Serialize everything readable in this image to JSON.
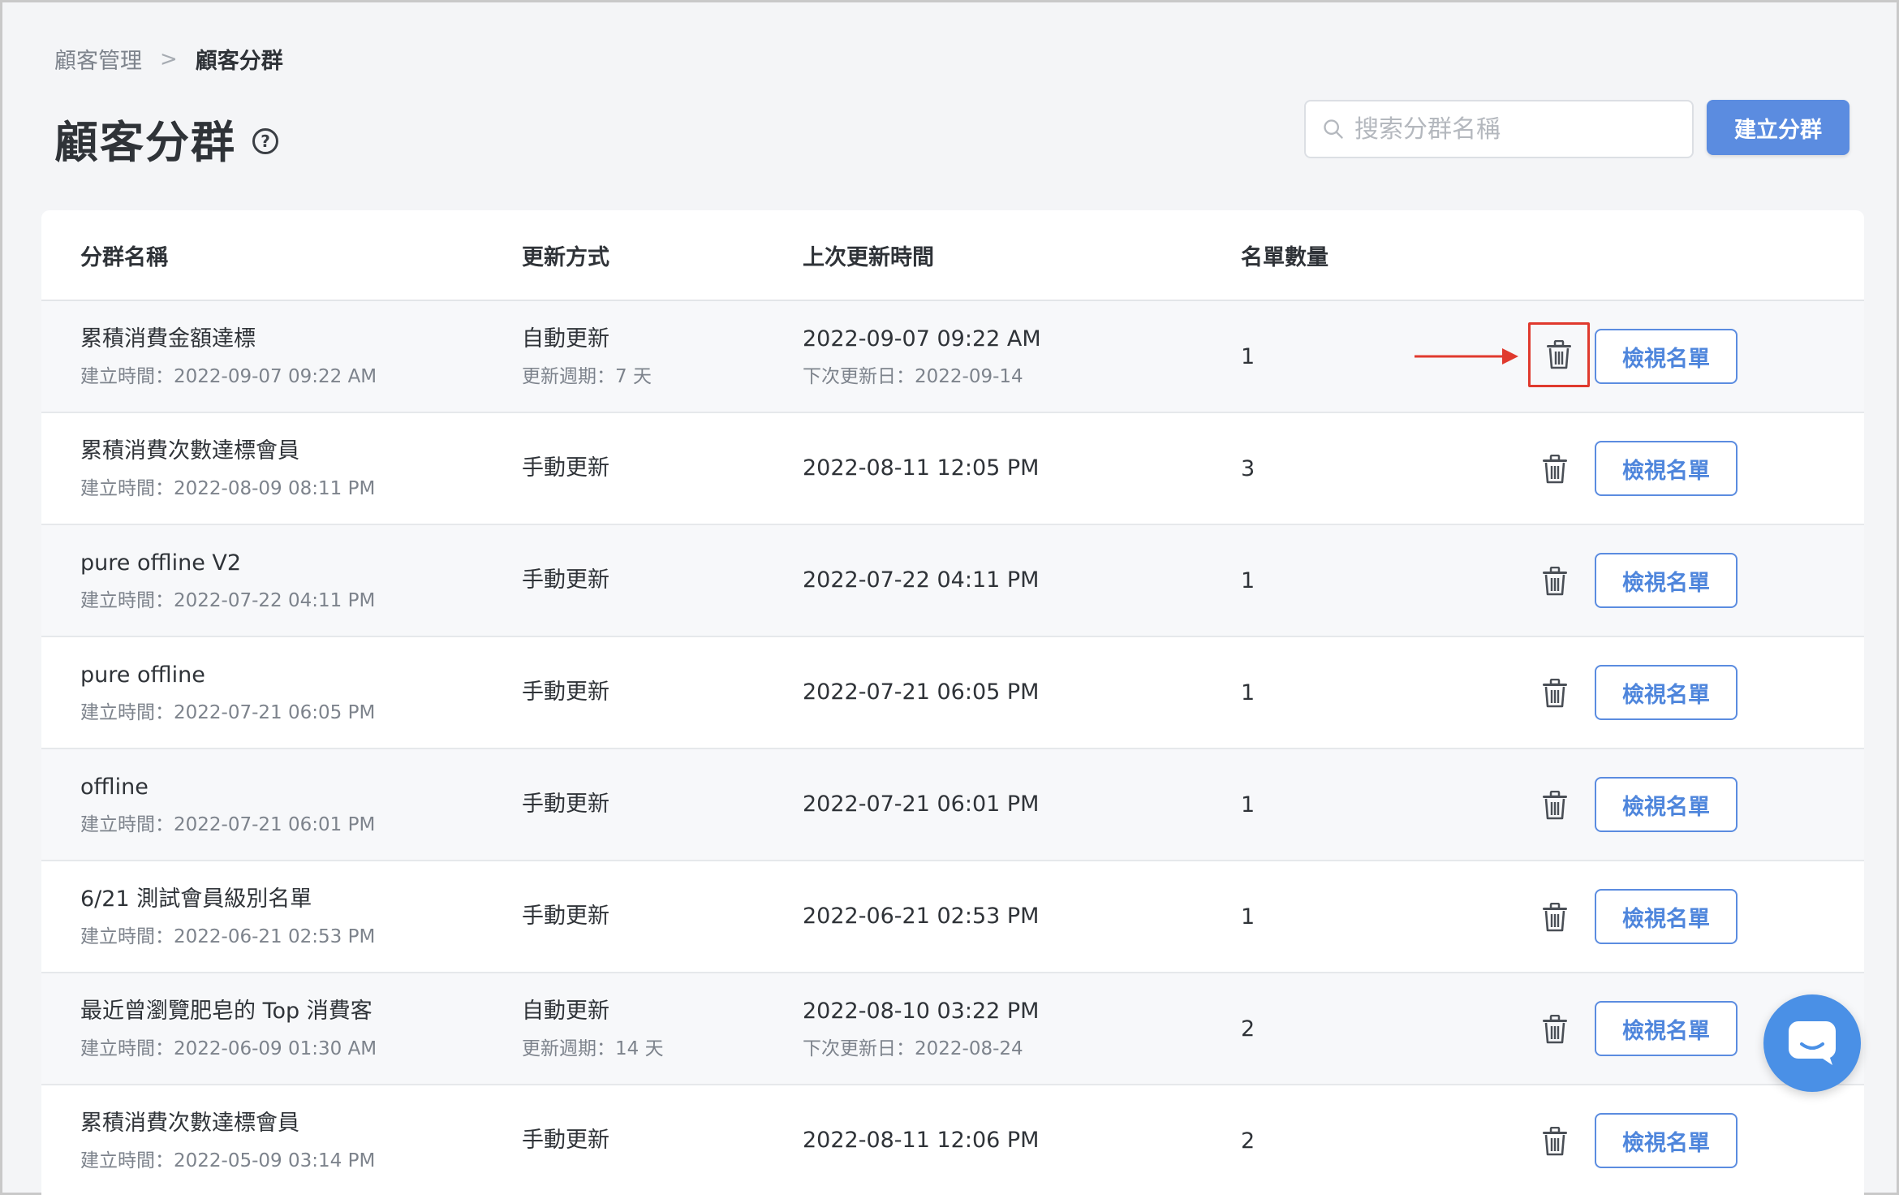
{
  "breadcrumb": {
    "parent": "顧客管理",
    "separator": ">",
    "current": "顧客分群"
  },
  "page_title": "顧客分群",
  "help_glyph": "?",
  "search": {
    "placeholder": "搜索分群名稱",
    "value": ""
  },
  "create_button": "建立分群",
  "table": {
    "headers": {
      "name": "分群名稱",
      "mode": "更新方式",
      "last_updated": "上次更新時間",
      "count": "名單數量"
    },
    "view_label": "檢視名單",
    "rows": [
      {
        "name": "累積消費金額達標",
        "created": "建立時間：2022-09-07 09:22 AM",
        "mode": "自動更新",
        "mode_sub": "更新週期：7 天",
        "last_updated": "2022-09-07 09:22 AM",
        "next_update": "下次更新日：2022-09-14",
        "count": "1"
      },
      {
        "name": "累積消費次數達標會員",
        "created": "建立時間：2022-08-09 08:11 PM",
        "mode": "手動更新",
        "mode_sub": "",
        "last_updated": "2022-08-11 12:05 PM",
        "next_update": "",
        "count": "3"
      },
      {
        "name": "pure offline V2",
        "created": "建立時間：2022-07-22 04:11 PM",
        "mode": "手動更新",
        "mode_sub": "",
        "last_updated": "2022-07-22 04:11 PM",
        "next_update": "",
        "count": "1"
      },
      {
        "name": "pure offline",
        "created": "建立時間：2022-07-21 06:05 PM",
        "mode": "手動更新",
        "mode_sub": "",
        "last_updated": "2022-07-21 06:05 PM",
        "next_update": "",
        "count": "1"
      },
      {
        "name": "offline",
        "created": "建立時間：2022-07-21 06:01 PM",
        "mode": "手動更新",
        "mode_sub": "",
        "last_updated": "2022-07-21 06:01 PM",
        "next_update": "",
        "count": "1"
      },
      {
        "name": "6/21 測試會員級別名單",
        "created": "建立時間：2022-06-21 02:53 PM",
        "mode": "手動更新",
        "mode_sub": "",
        "last_updated": "2022-06-21 02:53 PM",
        "next_update": "",
        "count": "1"
      },
      {
        "name": "最近曾瀏覽肥皂的 Top 消費客",
        "created": "建立時間：2022-06-09 01:30 AM",
        "mode": "自動更新",
        "mode_sub": "更新週期：14 天",
        "last_updated": "2022-08-10 03:22 PM",
        "next_update": "下次更新日：2022-08-24",
        "count": "2"
      },
      {
        "name": "累積消費次數達標會員",
        "created": "建立時間：2022-05-09 03:14 PM",
        "mode": "手動更新",
        "mode_sub": "",
        "last_updated": "2022-08-11 12:06 PM",
        "next_update": "",
        "count": "2"
      }
    ]
  },
  "icons": {
    "search": "search-icon",
    "trash": "trash-icon",
    "help": "help-circle-icon",
    "chat": "chat-icon",
    "arrow": "annotation-arrow"
  },
  "colors": {
    "accent": "#5b8ce0",
    "highlight": "#e03a2e",
    "chat": "#4a90e6"
  }
}
